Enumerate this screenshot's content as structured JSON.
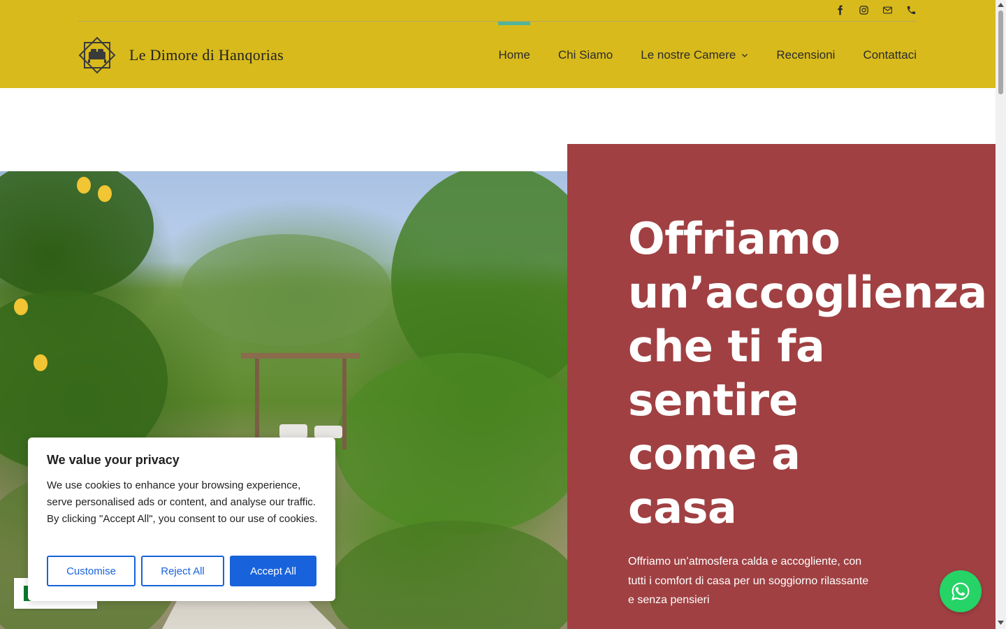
{
  "site": {
    "logo_text": "Le Dimore di Hanqorias",
    "header_bg": "#d8ba1c",
    "accent_nav": "#52b59a"
  },
  "social_icons": [
    "facebook-icon",
    "instagram-icon",
    "mail-icon",
    "phone-icon"
  ],
  "nav": {
    "items": [
      {
        "label": "Home",
        "active": true
      },
      {
        "label": "Chi Siamo"
      },
      {
        "label": "Le nostre Camere",
        "has_dropdown": true
      },
      {
        "label": "Recensioni"
      },
      {
        "label": "Contattaci"
      }
    ]
  },
  "hero": {
    "panel_color": "#a04042",
    "headline_lines": [
      "Offriamo",
      "un’accoglienza",
      "che ti fa",
      "sentire",
      "come a",
      "casa"
    ],
    "subtext": "Offriamo un’atmosfera calda e accogliente, con tutti i comfort di casa per un soggiorno rilassante e senza pensieri"
  },
  "cookie": {
    "title": "We value your privacy",
    "text": "We use cookies to enhance your browsing experience, serve personalised ads or content, and analyse our traffic. By clicking \"Accept All\", you consent to our use of cookies.",
    "customise_label": "Customise",
    "reject_label": "Reject All",
    "accept_label": "Accept All",
    "button_color": "#1863dc"
  },
  "whatsapp": {
    "icon": "whatsapp-icon",
    "color": "#25d366"
  }
}
